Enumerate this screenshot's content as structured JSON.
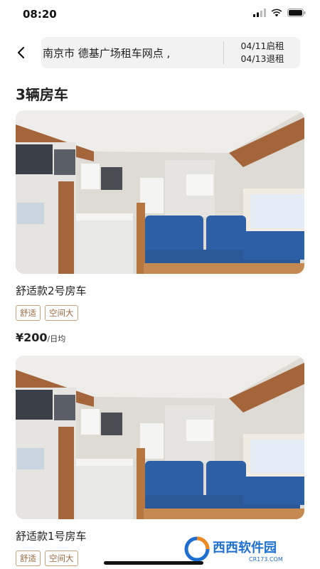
{
  "status_bar": {
    "time": "08:20"
  },
  "header": {
    "back_icon": "chevron-left-icon",
    "location": "南京市 德基广场租车网点 ,",
    "pickup_date": "04/11启租",
    "return_date": "04/13退租"
  },
  "list": {
    "title": "3辆房车",
    "cards": [
      {
        "name": "舒适款2号房车",
        "tags": [
          "舒适",
          "空间大"
        ],
        "price": "¥200",
        "price_unit": "/日均"
      },
      {
        "name": "舒适款1号房车",
        "tags": [
          "舒适",
          "空间大"
        ]
      }
    ]
  },
  "watermark": {
    "brand_cn": "西西软件园",
    "brand_en": "CR173.COM"
  },
  "colors": {
    "tag_border": "#c9a27c",
    "tag_text": "#9a6a3f",
    "watermark_blue": "#1d6fd1",
    "watermark_orange": "#f08a1c"
  }
}
